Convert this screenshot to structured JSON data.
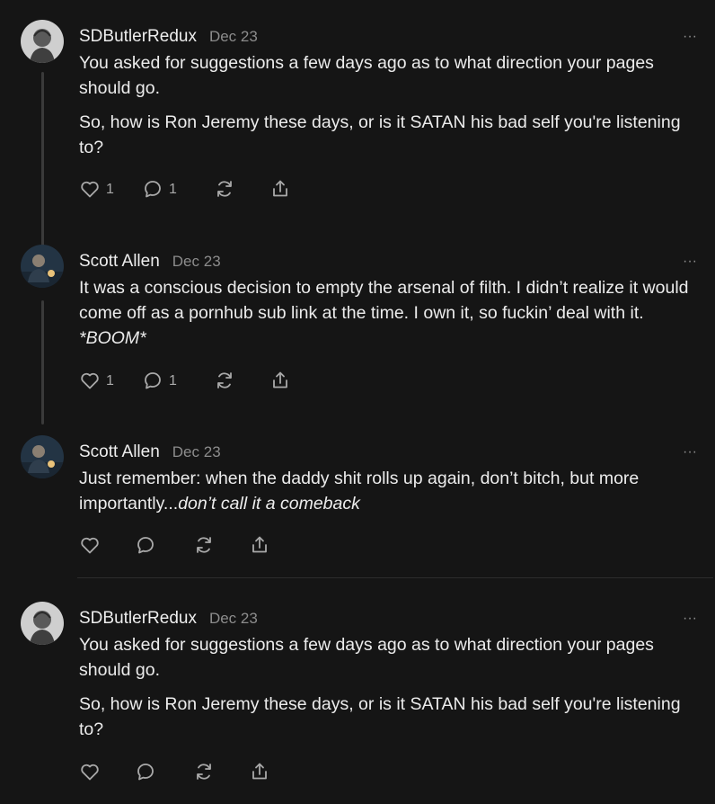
{
  "comments": [
    {
      "author": "SDButlerRedux",
      "date": "Dec 23",
      "paragraphs": [
        "You asked for suggestions a few days ago as to what direction your pages should go.",
        "So, how is Ron Jeremy these days, or is it SATAN his bad self you're listening to?"
      ],
      "likes": "1",
      "replies": "1"
    },
    {
      "author": "Scott Allen",
      "date": "Dec 23",
      "text_a": "It was a conscious decision to empty the arsenal of filth. I didn’t realize it would come off as a pornhub sub link at the time. I own it, so fuckin’ deal with it. ",
      "text_b": "*BOOM*",
      "likes": "1",
      "replies": "1"
    },
    {
      "author": "Scott Allen",
      "date": "Dec 23",
      "text_a": "Just remember: when the daddy shit rolls up again, don’t bitch, but more importantly...",
      "text_b": "don’t call it a comeback"
    },
    {
      "author": "SDButlerRedux",
      "date": "Dec 23",
      "paragraphs": [
        "You asked for suggestions a few days ago as to what direction your pages should go.",
        "So, how is Ron Jeremy these days, or is it SATAN his bad self you're listening to?"
      ]
    }
  ],
  "more_glyph": "···",
  "icons": [
    "heart-icon",
    "comment-icon",
    "restack-icon",
    "share-icon",
    "more-icon"
  ]
}
